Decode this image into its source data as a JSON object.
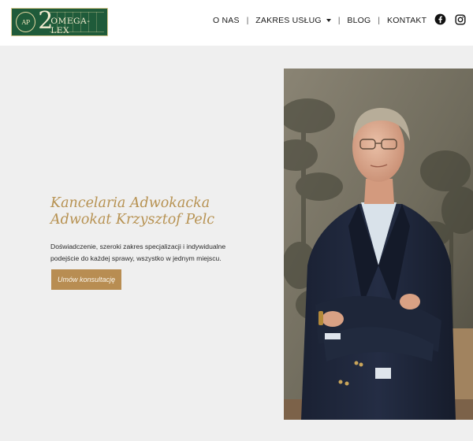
{
  "header": {
    "logo": {
      "mark": "AP",
      "two": "2",
      "text": "OMEGA-LEX"
    },
    "nav": {
      "items": [
        {
          "label": "O NAS"
        },
        {
          "label": "ZAKRES USŁUG",
          "has_dropdown": true
        },
        {
          "label": "BLOG"
        },
        {
          "label": "KONTAKT"
        }
      ],
      "separator": "|"
    },
    "social": [
      {
        "icon": "facebook-icon"
      },
      {
        "icon": "instagram-icon"
      }
    ]
  },
  "hero": {
    "title_line1": "Kancelaria Adwokacka",
    "title_line2": "Adwokat Krzysztof Pelc",
    "description": "Doświadczenie, szeroki zakres specjalizacji i indywidualne podejście do każdej sprawy, wszystko w jednym miejscu.",
    "cta_label": "Umów konsultację",
    "photo_icon": "portrait-photo"
  },
  "colors": {
    "accent_gold": "#b88d52",
    "title_gold": "#b79252",
    "logo_green": "#1f5b3a",
    "hero_bg": "#efefef",
    "suit_navy": "#1d2436"
  }
}
